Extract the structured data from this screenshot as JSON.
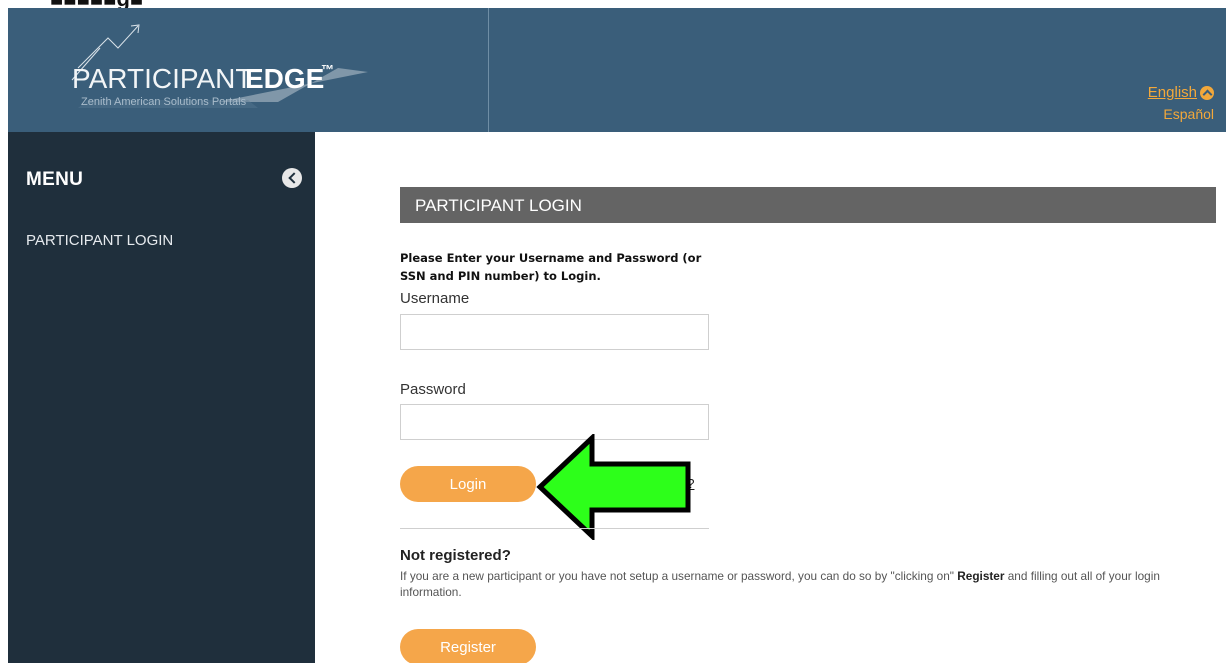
{
  "brand": {
    "name_part1": "PARTICIPANT",
    "name_part2": "EDGE",
    "trademark": "™",
    "tagline": "Zenith American Solutions Portals"
  },
  "language": {
    "current": "English",
    "other": "Español"
  },
  "sidebar": {
    "title": "MENU",
    "items": [
      {
        "label": "PARTICIPANT LOGIN"
      }
    ]
  },
  "login": {
    "header": "PARTICIPANT LOGIN",
    "instructions": "Please Enter your Username and Password (or SSN and PIN number) to Login.",
    "username_label": "Username",
    "username_value": "",
    "password_label": "Password",
    "password_value": "",
    "login_button": "Login",
    "forgot_link_visible": "d?"
  },
  "register": {
    "heading": "Not registered?",
    "text_before": "If you are a new participant or you have not setup a username or password, you can do so by \"clicking on\" ",
    "text_bold": "Register",
    "text_after": " and filling out all of your login information.",
    "button": "Register"
  },
  "colors": {
    "header_bg": "#3a5e7a",
    "sidebar_bg": "#1f2f3c",
    "panel_header_bg": "#646464",
    "accent_orange": "#f5a64a",
    "annotation_arrow": "#2dff1a"
  }
}
